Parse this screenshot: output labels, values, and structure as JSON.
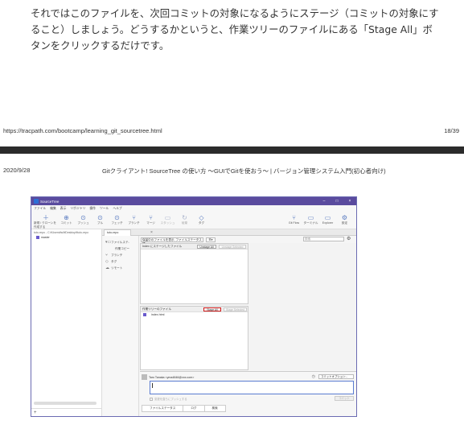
{
  "page1": {
    "line1": "それではこのファイルを、次回コミットの対象になるようにステージ（コミットの対象にす",
    "line2": "ること）しましょう。どうするかというと、作業ツリーのファイルにある「Stage All」ボ",
    "line3": "タンをクリックするだけです。",
    "url": "https://tracpath.com/bootcamp/learning_git_sourcetree.html",
    "page_number": "18/39"
  },
  "page2_header": {
    "date": "2020/9/28",
    "title": "Gitクライアント! SourceTree の使い方 ～GUIでGitを使おう～ | バージョン管理システム入門(初心者向け)"
  },
  "sourcetree": {
    "window_title": "SourceTree",
    "window_controls": [
      "–",
      "□",
      "×"
    ],
    "menu": [
      "ファイル",
      "編集",
      "表示",
      "リポジトリ",
      "操作",
      "ツール",
      "ヘルプ"
    ],
    "toolbar_left": [
      {
        "label": "新規 / クローンを作成する",
        "icon": "plus-icon",
        "glyph": "＋",
        "enabled": true
      },
      {
        "label": "コミット",
        "icon": "commit-icon",
        "glyph": "⊕",
        "enabled": true
      },
      {
        "label": "プッシュ",
        "icon": "push-icon",
        "glyph": "⊙",
        "enabled": true
      },
      {
        "label": "プル",
        "icon": "pull-icon",
        "glyph": "⊙",
        "enabled": true
      },
      {
        "label": "フェッチ",
        "icon": "fetch-icon",
        "glyph": "⊙",
        "enabled": true
      },
      {
        "label": "ブランチ",
        "icon": "branch-icon",
        "glyph": "⑂",
        "enabled": true
      },
      {
        "label": "マージ",
        "icon": "merge-icon",
        "glyph": "⑂",
        "enabled": true
      },
      {
        "label": "スタッシュ",
        "icon": "stash-icon",
        "glyph": "▭",
        "enabled": false
      },
      {
        "label": "破棄",
        "icon": "discard-icon",
        "glyph": "↻",
        "enabled": false
      },
      {
        "label": "タグ",
        "icon": "tag-icon",
        "glyph": "◇",
        "enabled": true
      }
    ],
    "toolbar_right": [
      {
        "label": "Git Flow",
        "icon": "gitflow-icon",
        "glyph": "⑂"
      },
      {
        "label": "ターミナル",
        "icon": "terminal-icon",
        "glyph": "▭"
      },
      {
        "label": "Explorer",
        "icon": "explorer-icon",
        "glyph": "▭"
      },
      {
        "label": "設定",
        "icon": "settings-gear-icon",
        "glyph": "⚙"
      }
    ],
    "repo_path": "tuto-repo - C:¥Users¥sd¥Desktop¥tuto-repo",
    "branch": "master",
    "tab_label": "tuto-repo",
    "nav": {
      "file_status": "ファイルステ-",
      "working_copy": "作業コピー",
      "branches": "ブランチ",
      "tags": "タグ",
      "remotes": "リモート"
    },
    "filter_select": "保留中のファイルを表示, ファイルステータス順",
    "search_placeholder": "検索",
    "staged_header": "Index にステージしたファイル",
    "unstage_all": "Unstage All",
    "unstage_selected": "Unstage Selected",
    "unstaged_header": "作業ツリーのファイル",
    "stage_all": "Stage All",
    "stage_selected": "Stage Selected",
    "unstaged_file": "index.html",
    "author": "Taro Tanaka <yma4846@xxx.com>",
    "commit_options": "コミットオプション...",
    "push_immediately": "変更を直ちにプッシュする",
    "commit_button": "コミット",
    "bottom_tabs": [
      "ファイルステータス",
      "ログ",
      "検索"
    ],
    "colors": {
      "titlebar": "#5a4b9e",
      "accent": "#5a7bd1",
      "highlight_border": "#d21a1a"
    }
  }
}
